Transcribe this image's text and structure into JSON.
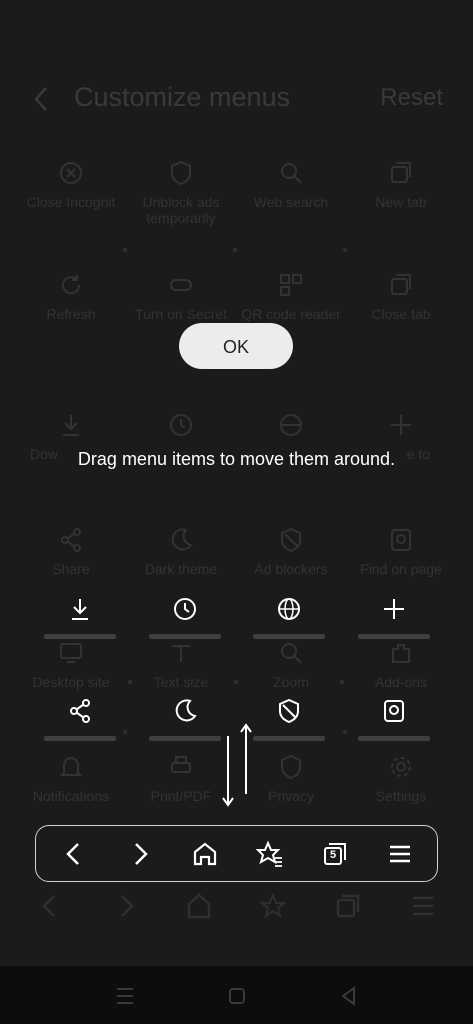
{
  "header": {
    "title": "Customize menus",
    "reset_label": "Reset"
  },
  "dialog": {
    "message": "Drag menu items to move them around.",
    "ok_label": "OK"
  },
  "background_items": [
    {
      "label": "Close Incognit",
      "icon": "incognito-icon"
    },
    {
      "label": "Unblock ads temporarily",
      "icon": "ad-shield-icon"
    },
    {
      "label": "Web search",
      "icon": "search-icon"
    },
    {
      "label": "New tab",
      "icon": "new-tab-icon"
    },
    {
      "label": "Refresh",
      "icon": "refresh-icon"
    },
    {
      "label": "Turn on Secret",
      "icon": "secret-mode-icon"
    },
    {
      "label": "QR code reader",
      "icon": "qr-icon"
    },
    {
      "label": "Close tab",
      "icon": "close-tab-icon"
    },
    {
      "label": "Dow",
      "icon": "download-icon"
    },
    {
      "label": "",
      "icon": "history-icon"
    },
    {
      "label": "",
      "icon": "translate-icon"
    },
    {
      "label": "e to",
      "icon": "add-icon"
    },
    {
      "label": "Share",
      "icon": "share-icon"
    },
    {
      "label": "Dark theme",
      "icon": "dark-theme-icon"
    },
    {
      "label": "Ad blockers",
      "icon": "ad-blocker-icon"
    },
    {
      "label": "Find on page",
      "icon": "find-on-page-icon"
    },
    {
      "label": "Desktop site",
      "icon": "desktop-icon"
    },
    {
      "label": "Text size",
      "icon": "text-size-icon"
    },
    {
      "label": "Zoom",
      "icon": "zoom-icon"
    },
    {
      "label": "Add-ons",
      "icon": "addons-icon"
    },
    {
      "label": "Notifications",
      "icon": "bell-icon"
    },
    {
      "label": "Print/PDF",
      "icon": "print-icon"
    },
    {
      "label": "Privacy",
      "icon": "privacy-icon"
    },
    {
      "label": "Settings",
      "icon": "gear-icon"
    }
  ],
  "toolbar": {
    "tab_count": "5"
  },
  "colors": {
    "background": "#1b1b1b",
    "dimmed_text": "#333333",
    "overlay_text": "#ffffff",
    "ok_button": "#ececec"
  }
}
